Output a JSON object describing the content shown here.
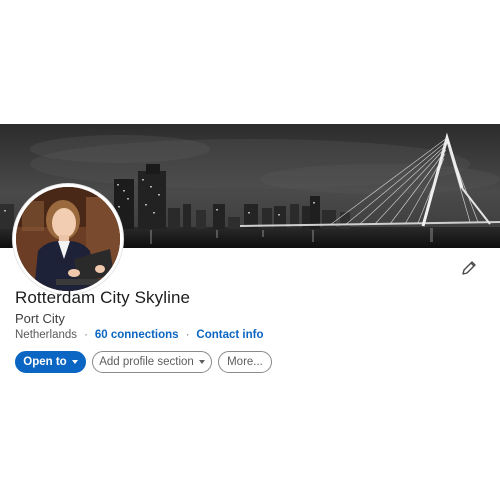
{
  "profile": {
    "name": "Rotterdam City Skyline",
    "headline": "Port City",
    "location": "Netherlands",
    "connections_label": "60 connections",
    "contact_label": "Contact info",
    "separator": "·"
  },
  "actions": {
    "open_to_label": "Open to",
    "add_section_label": "Add profile section",
    "more_label": "More..."
  },
  "banner": {
    "subject": "black-and-white night skyline with cable-stayed bridge"
  },
  "icons": [
    "pencil-icon",
    "caret-down-icon"
  ],
  "colors": {
    "primary": "#0a66c2",
    "text": "#1d1d1d",
    "muted": "#5a5a5a"
  }
}
